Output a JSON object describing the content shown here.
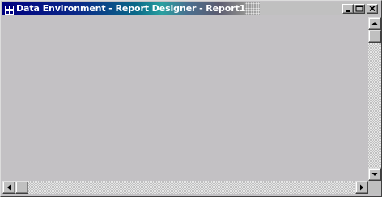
{
  "window": {
    "title": "Data Environment - Report Designer - Report1",
    "icon": "report-designer-icon"
  },
  "titlebar_buttons": [
    {
      "name": "minimize",
      "icon": "minimize-icon"
    },
    {
      "name": "maximize",
      "icon": "maximize-icon"
    },
    {
      "name": "close",
      "icon": "close-icon"
    }
  ],
  "scrollbars": {
    "vertical": {
      "up_icon": "arrow-up-icon",
      "down_icon": "arrow-down-icon",
      "position": 0
    },
    "horizontal": {
      "left_icon": "arrow-left-icon",
      "right_icon": "arrow-right-icon",
      "position": 0
    }
  },
  "colors": {
    "titlebar_active": "#000080",
    "titlebar_text": "#ffffff",
    "face": "#c0c0c0",
    "client_background": "#c3c1c4"
  }
}
